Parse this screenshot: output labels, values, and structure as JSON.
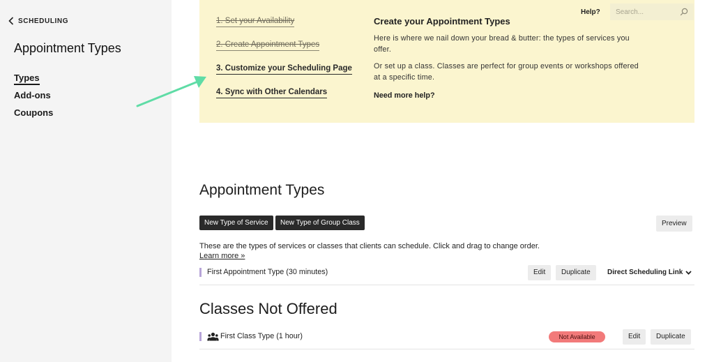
{
  "sidebar": {
    "back_label": "SCHEDULING",
    "title": "Appointment Types",
    "items": [
      {
        "label": "Types",
        "active": true
      },
      {
        "label": "Add-ons",
        "active": false
      },
      {
        "label": "Coupons",
        "active": false
      }
    ]
  },
  "onboarding": {
    "steps": [
      {
        "label": "1. Set your Availability",
        "done": true
      },
      {
        "label": "2. Create Appointment Types",
        "done": true
      },
      {
        "label": "3. Customize your Scheduling Page",
        "done": false
      },
      {
        "label": "4. Sync with Other Calendars",
        "done": false
      }
    ],
    "title": "Create your Appointment Types",
    "paragraph1": "Here is where we nail down your bread & butter: the types of services you offer.",
    "paragraph2": "Or set up a class. Classes are perfect for group events or workshops offered at a specific time.",
    "help_text": "Need more help?",
    "accent_color": "#fbf5cf"
  },
  "topbar": {
    "help_label": "Help?",
    "search_placeholder": "Search..."
  },
  "main": {
    "title": "Appointment Types",
    "new_service_button": "New Type of Service",
    "new_class_button": "New Type of Group Class",
    "preview_button": "Preview",
    "description": "These are the types of services or classes that clients can schedule. Click and drag to change order.",
    "learn_more": "Learn more »",
    "appointment_rows": [
      {
        "label": "First Appointment Type (30 minutes)",
        "edit": "Edit",
        "duplicate": "Duplicate",
        "link": "Direct Scheduling Link"
      }
    ],
    "classes_title": "Classes Not Offered",
    "class_rows": [
      {
        "label": "First Class Type (1 hour)",
        "status": "Not Available",
        "edit": "Edit",
        "duplicate": "Duplicate"
      }
    ]
  },
  "colors": {
    "arrow": "#5fdca6",
    "badge": "#f27a7a",
    "row_marker": "#b7a4d8"
  }
}
